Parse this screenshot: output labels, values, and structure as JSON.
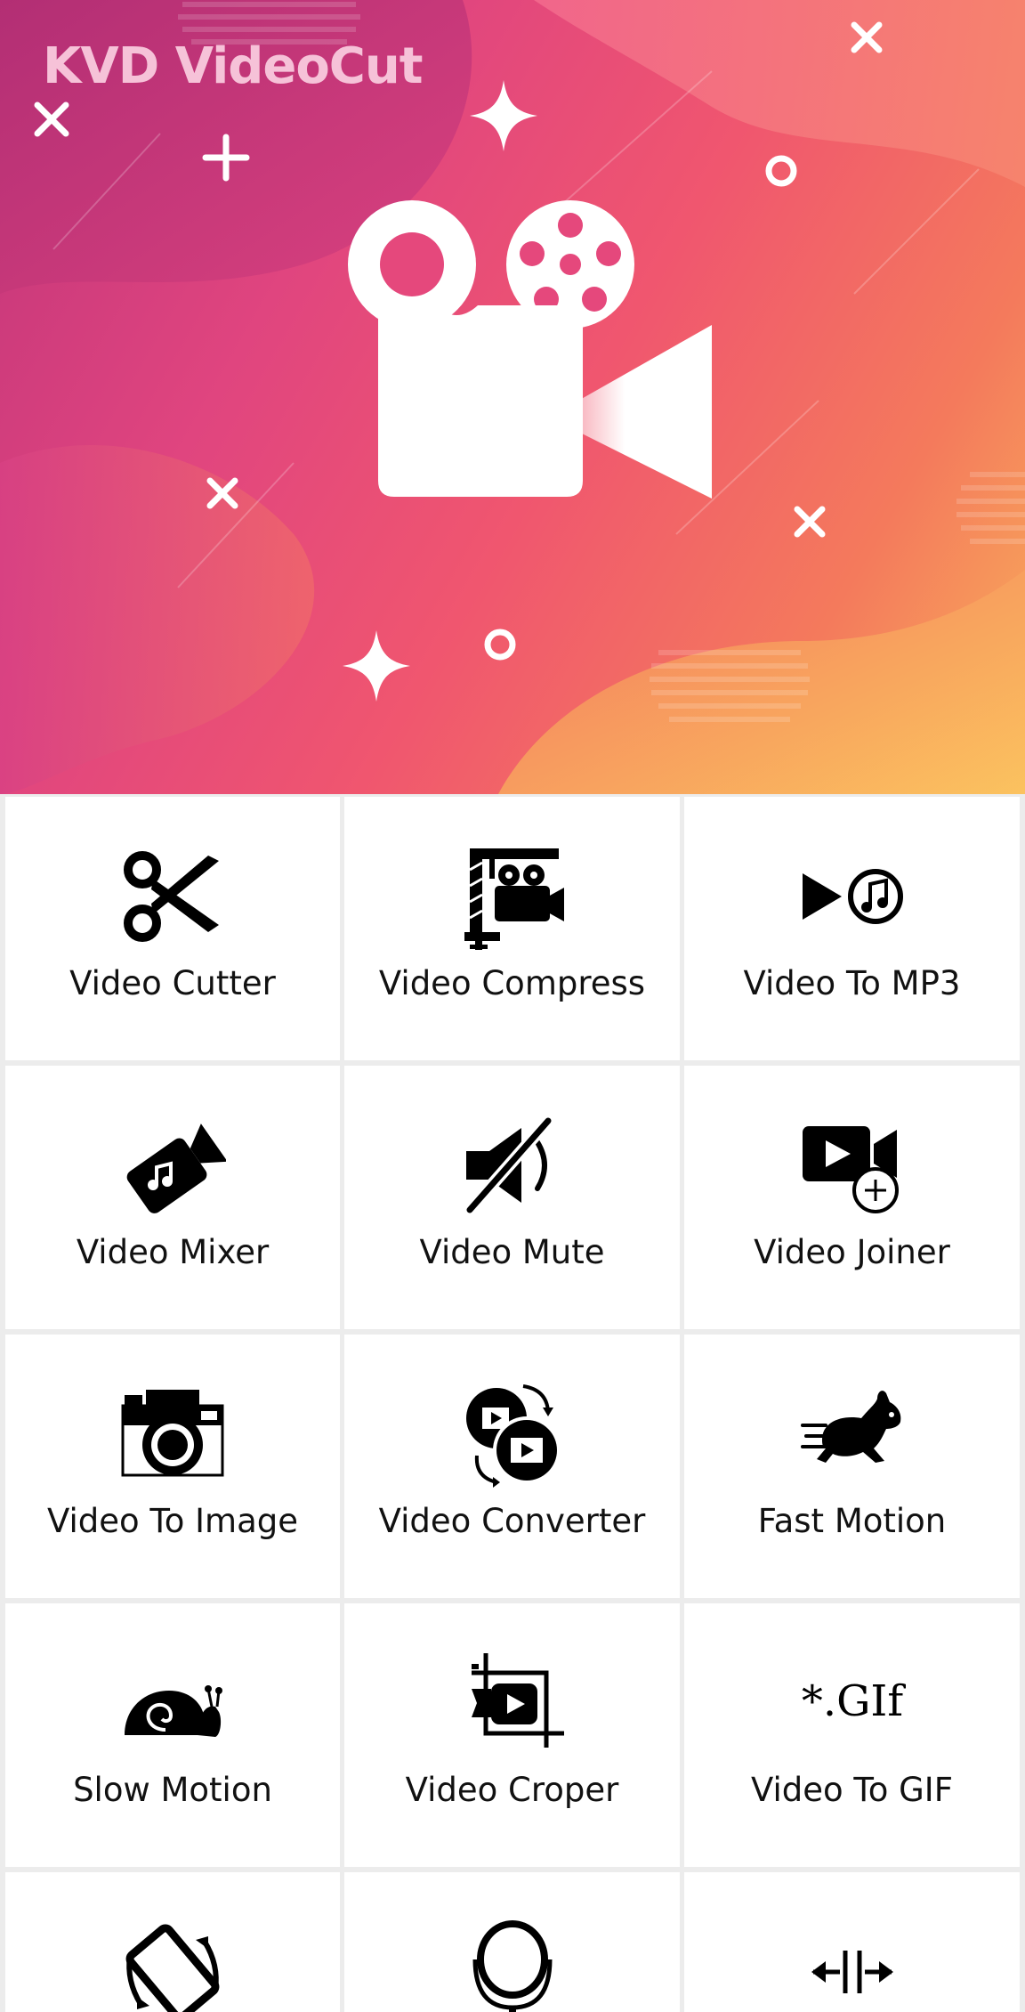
{
  "app": {
    "title": "KVD VideoCut"
  },
  "colors": {
    "banner_start": "#c0347a",
    "banner_mid": "#f0566f",
    "banner_end": "#f9b25a",
    "title_text": "#f6c2d8",
    "tile_background": "#ffffff",
    "grid_divider": "#ececec",
    "label_text": "#111111",
    "icon_color": "#000000"
  },
  "logo": {
    "icon": "video-camera-icon"
  },
  "tools": [
    {
      "label": "Video Cutter",
      "icon": "scissors-icon"
    },
    {
      "label": "Video Compress",
      "icon": "clamp-camera-icon"
    },
    {
      "label": "Video To MP3",
      "icon": "play-music-icon"
    },
    {
      "label": "Video Mixer",
      "icon": "music-camera-icon"
    },
    {
      "label": "Video Mute",
      "icon": "speaker-mute-icon"
    },
    {
      "label": "Video Joiner",
      "icon": "video-add-icon"
    },
    {
      "label": "Video To Image",
      "icon": "camera-icon"
    },
    {
      "label": "Video Converter",
      "icon": "convert-reels-icon"
    },
    {
      "label": "Fast Motion",
      "icon": "rabbit-icon"
    },
    {
      "label": "Slow Motion",
      "icon": "snail-icon"
    },
    {
      "label": "Video Croper",
      "icon": "crop-video-icon"
    },
    {
      "label": "Video To GIF",
      "icon": "gif-icon",
      "icon_text": "*.GIf"
    },
    {
      "label": "",
      "icon": "rotate-phone-icon"
    },
    {
      "label": "",
      "icon": "mirror-icon"
    },
    {
      "label": "",
      "icon": "flip-horizontal-icon"
    }
  ]
}
